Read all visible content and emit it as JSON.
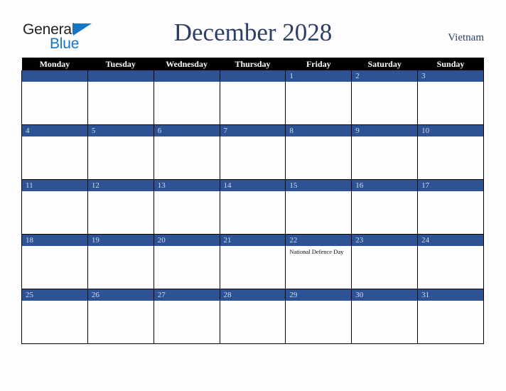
{
  "brand": {
    "word_one": "General",
    "word_two": "Blue",
    "triangle_color": "#1476c6",
    "word_one_color": "#231f20",
    "word_two_color": "#1476c6"
  },
  "header": {
    "title": "December 2028",
    "country": "Vietnam",
    "title_color": "#2c3e63",
    "country_color": "#2c3e63"
  },
  "calendar": {
    "accent_color": "#2e5394",
    "header_bg": "#010101",
    "weekdays": [
      "Monday",
      "Tuesday",
      "Wednesday",
      "Thursday",
      "Friday",
      "Saturday",
      "Sunday"
    ],
    "weeks": [
      [
        {
          "date": "",
          "events": []
        },
        {
          "date": "",
          "events": []
        },
        {
          "date": "",
          "events": []
        },
        {
          "date": "",
          "events": []
        },
        {
          "date": "1",
          "events": []
        },
        {
          "date": "2",
          "events": []
        },
        {
          "date": "3",
          "events": []
        }
      ],
      [
        {
          "date": "4",
          "events": []
        },
        {
          "date": "5",
          "events": []
        },
        {
          "date": "6",
          "events": []
        },
        {
          "date": "7",
          "events": []
        },
        {
          "date": "8",
          "events": []
        },
        {
          "date": "9",
          "events": []
        },
        {
          "date": "10",
          "events": []
        }
      ],
      [
        {
          "date": "11",
          "events": []
        },
        {
          "date": "12",
          "events": []
        },
        {
          "date": "13",
          "events": []
        },
        {
          "date": "14",
          "events": []
        },
        {
          "date": "15",
          "events": []
        },
        {
          "date": "16",
          "events": []
        },
        {
          "date": "17",
          "events": []
        }
      ],
      [
        {
          "date": "18",
          "events": []
        },
        {
          "date": "19",
          "events": []
        },
        {
          "date": "20",
          "events": []
        },
        {
          "date": "21",
          "events": []
        },
        {
          "date": "22",
          "events": [
            "National Defence Day"
          ]
        },
        {
          "date": "23",
          "events": []
        },
        {
          "date": "24",
          "events": []
        }
      ],
      [
        {
          "date": "25",
          "events": []
        },
        {
          "date": "26",
          "events": []
        },
        {
          "date": "27",
          "events": []
        },
        {
          "date": "28",
          "events": []
        },
        {
          "date": "29",
          "events": []
        },
        {
          "date": "30",
          "events": []
        },
        {
          "date": "31",
          "events": []
        }
      ]
    ]
  }
}
